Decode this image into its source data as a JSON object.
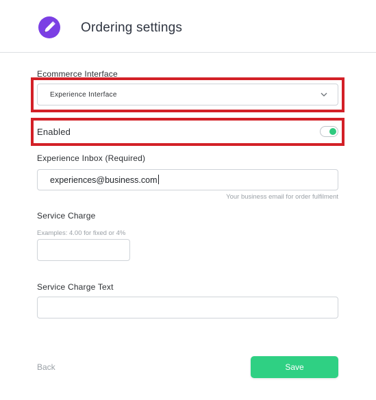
{
  "header": {
    "title": "Ordering settings",
    "logo_icon": "pencil-icon"
  },
  "ecommerce_interface": {
    "label": "Ecommerce Interface",
    "selected": "Experience Interface",
    "dropdown_icon": "chevron-down-icon"
  },
  "enabled": {
    "label": "Enabled",
    "state": "on"
  },
  "experience_inbox": {
    "label": "Experience Inbox (Required)",
    "value": "experiences@business.com",
    "hint": "Your business email for order fulfilment"
  },
  "service_charge": {
    "label": "Service Charge",
    "hint": "Examples: 4.00 for fixed or 4%",
    "value": ""
  },
  "service_charge_text": {
    "label": "Service Charge Text",
    "value": ""
  },
  "footer": {
    "back_label": "Back",
    "save_label": "Save"
  },
  "colors": {
    "accent": "#2fd083",
    "brand": "#7b3fe4",
    "highlight": "#d32027",
    "toggle_on": "#2fca7f"
  }
}
